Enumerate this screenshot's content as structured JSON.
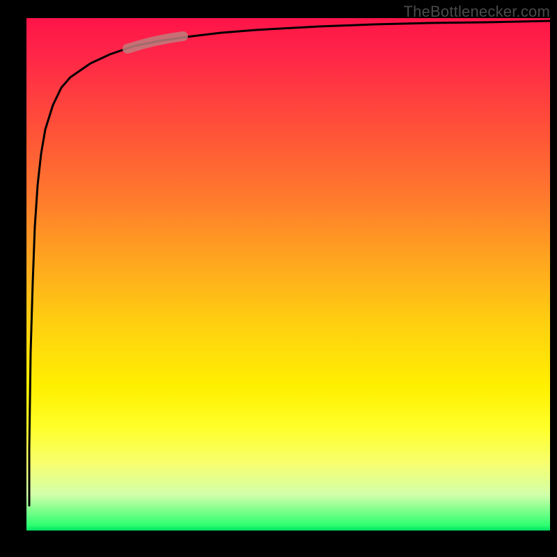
{
  "watermark": "TheBottlenecker.com",
  "chart_data": {
    "type": "line",
    "title": "",
    "xlabel": "",
    "ylabel": "",
    "xlim": [
      0,
      100
    ],
    "ylim": [
      0,
      100
    ],
    "series": [
      {
        "name": "curve",
        "x": [
          0.5,
          0.8,
          1.0,
          1.3,
          1.6,
          2.0,
          2.5,
          3.0,
          4.0,
          5.0,
          6.0,
          8.0,
          10,
          13,
          16,
          20,
          25,
          30,
          40,
          50,
          60,
          70,
          80,
          90,
          100
        ],
        "values": [
          5,
          15,
          28,
          40,
          50,
          58,
          65,
          70,
          77,
          81,
          84,
          87,
          89,
          91,
          92.5,
          93.5,
          94.5,
          95.2,
          96,
          96.5,
          97,
          97.3,
          97.6,
          97.8,
          98
        ]
      }
    ],
    "highlight": {
      "x_range": [
        16,
        25
      ],
      "color": "#be7e7e"
    },
    "background_gradient": [
      "#ff1449",
      "#ffd110",
      "#fff000",
      "#00e060"
    ]
  }
}
